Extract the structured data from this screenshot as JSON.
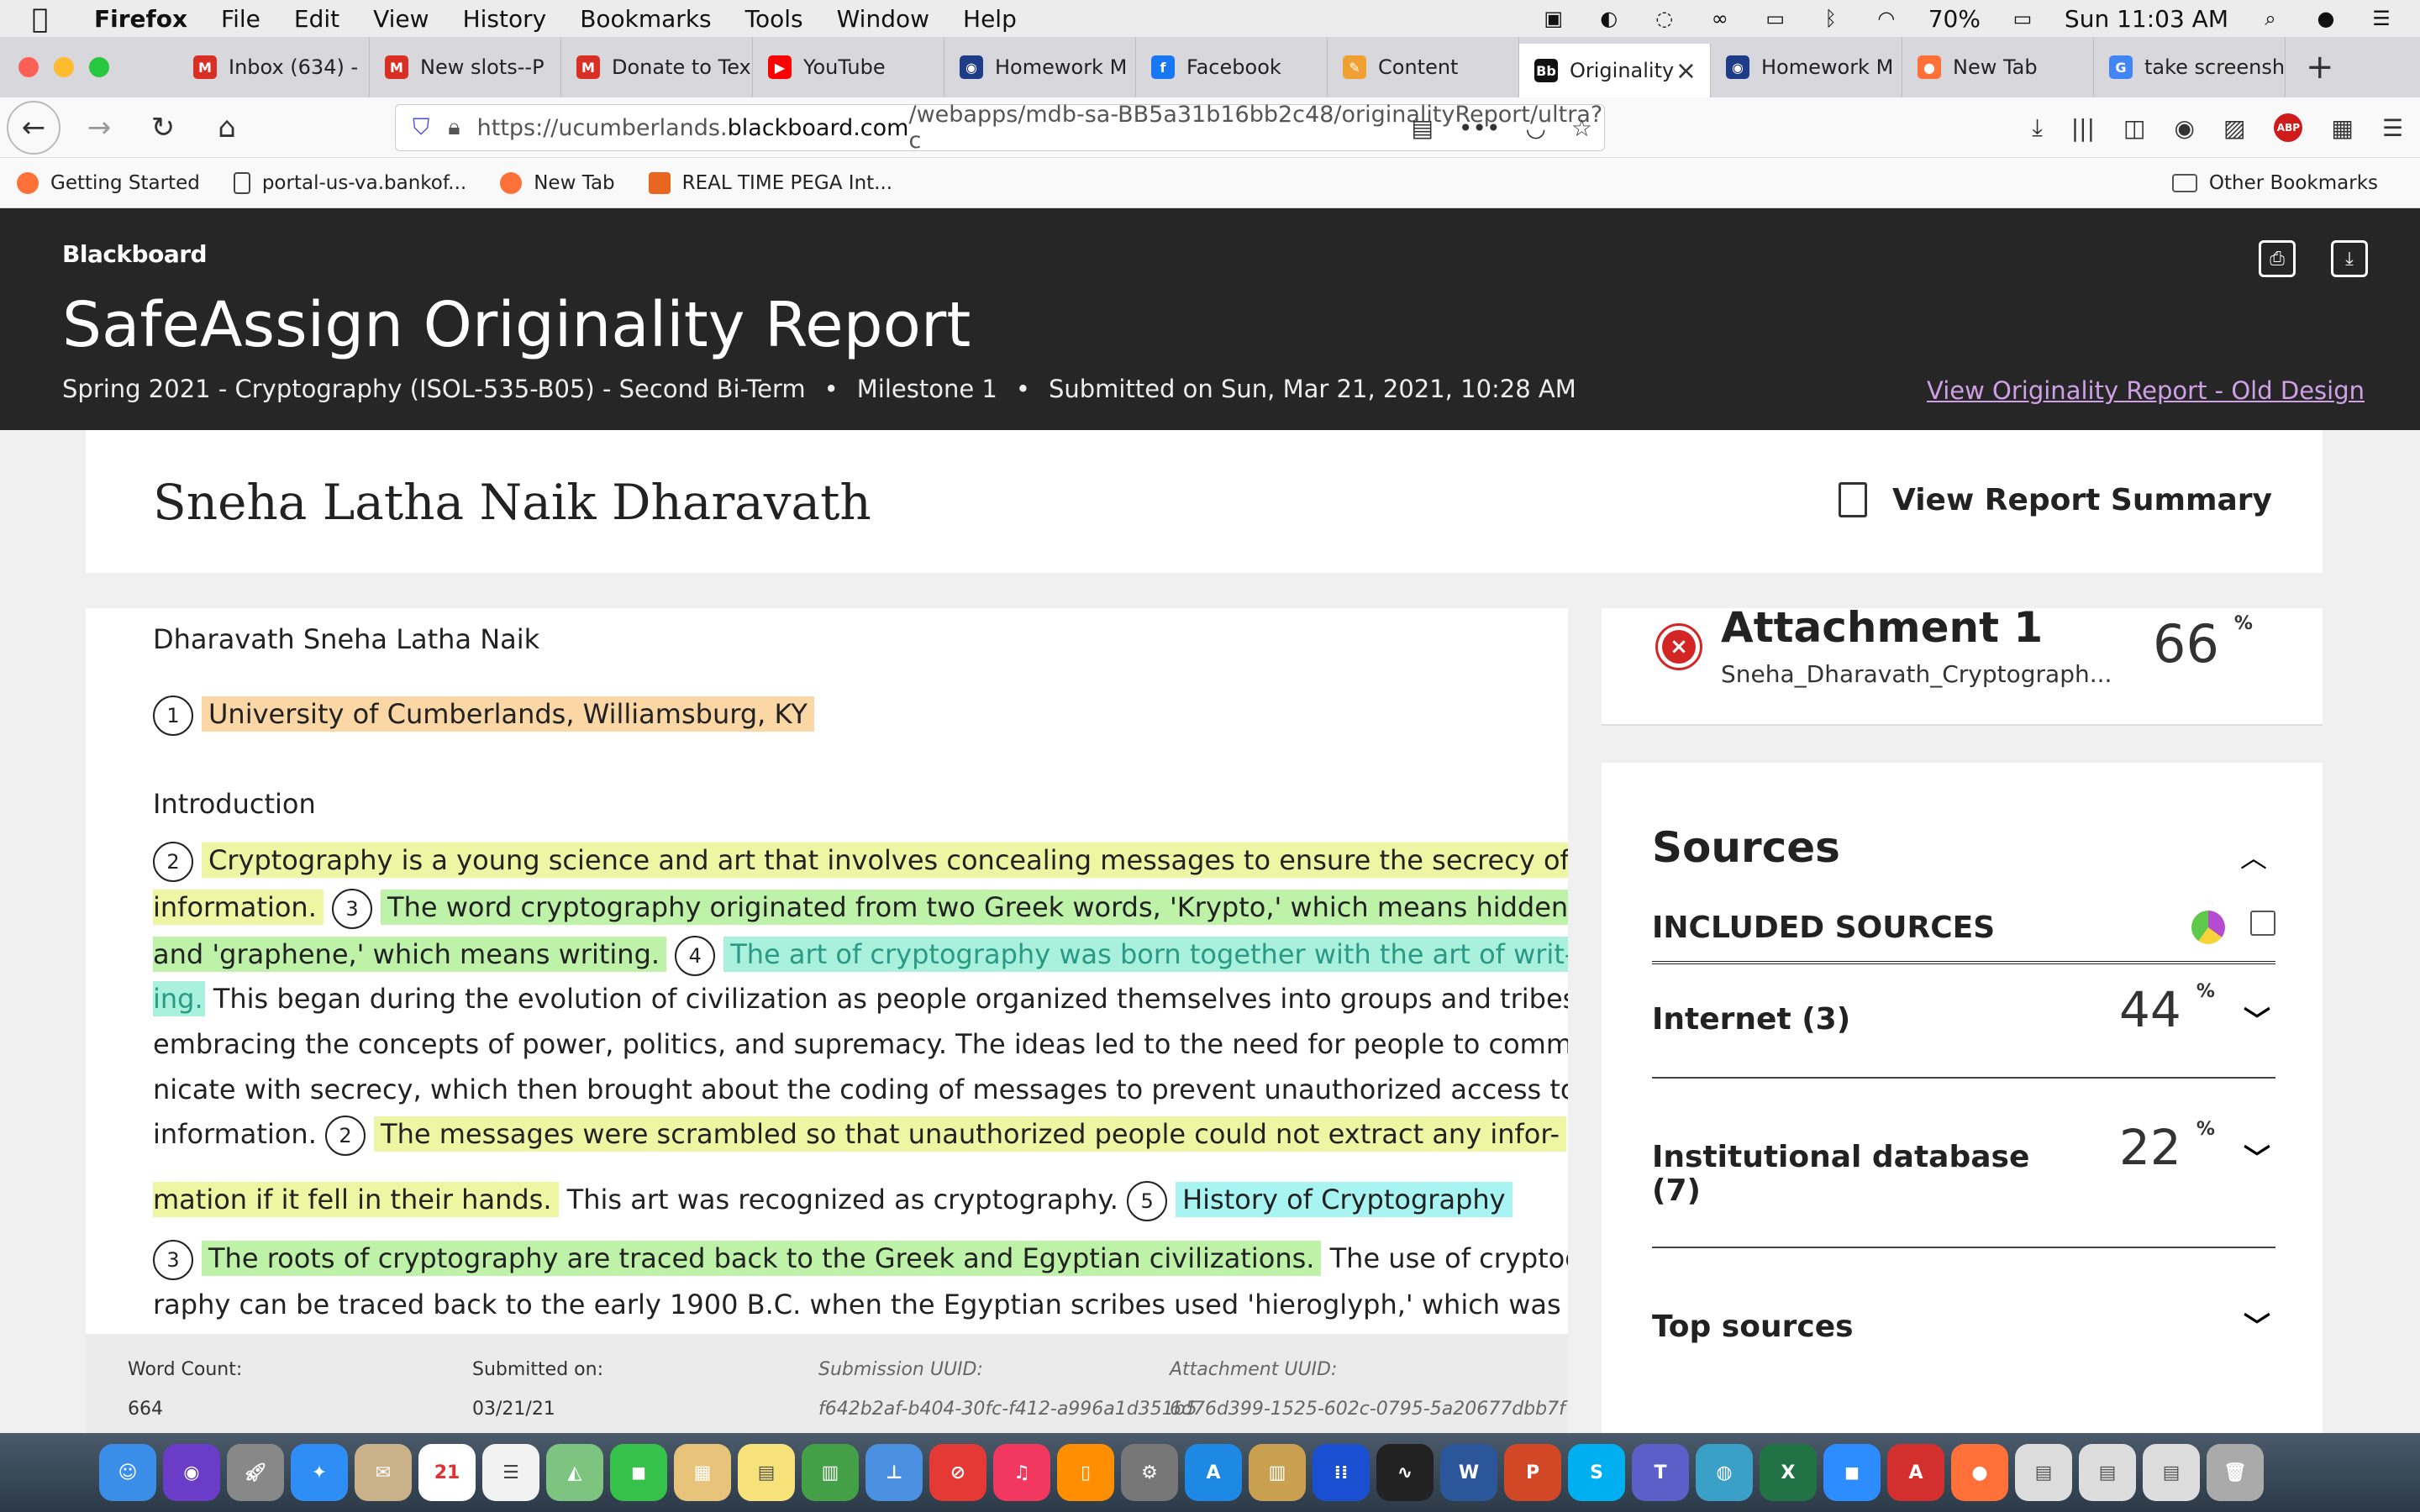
{
  "menubar": {
    "app": "Firefox",
    "items": [
      "File",
      "Edit",
      "View",
      "History",
      "Bookmarks",
      "Tools",
      "Window",
      "Help"
    ],
    "battery": "70%",
    "clock": "Sun 11:03 AM"
  },
  "tabs": [
    {
      "label": "Inbox (634) -",
      "color": "#d93025",
      "glyph": "M"
    },
    {
      "label": "New slots--P",
      "color": "#d93025",
      "glyph": "M"
    },
    {
      "label": "Donate to Tex",
      "color": "#d93025",
      "glyph": "M"
    },
    {
      "label": "YouTube",
      "color": "#ff0000",
      "glyph": "▶"
    },
    {
      "label": "Homework M",
      "color": "#1f3c88",
      "glyph": "◉"
    },
    {
      "label": "Facebook",
      "color": "#1877f2",
      "glyph": "f"
    },
    {
      "label": "Content",
      "color": "#f0a030",
      "glyph": "✎"
    },
    {
      "label": "Originality",
      "color": "#111111",
      "glyph": "Bb",
      "active": true
    },
    {
      "label": "Homework M",
      "color": "#1f3c88",
      "glyph": "◉"
    },
    {
      "label": "New Tab",
      "color": "#ff7139",
      "glyph": "●"
    },
    {
      "label": "take screensh",
      "color": "#4285f4",
      "glyph": "G"
    }
  ],
  "url": {
    "prefix": "https://ucumberlands.",
    "host": "blackboard.com",
    "path": "/webapps/mdb-sa-BB5a31b16bb2c48/originalityReport/ultra?c"
  },
  "bookmarks": {
    "items": [
      "Getting Started",
      "portal-us-va.bankof...",
      "New Tab",
      "REAL TIME PEGA Int..."
    ],
    "other": "Other Bookmarks"
  },
  "header": {
    "brand": "Blackboard",
    "title": "SafeAssign Originality Report",
    "course": "Spring 2021 - Cryptography (ISOL-535-B05) - Second Bi-Term",
    "milestone": "Milestone 1",
    "submitted": "Submitted on Sun, Mar 21, 2021, 10:28 AM",
    "old_design_link": "View Originality Report - Old Design"
  },
  "student": {
    "name": "Sneha Latha Naik Dharavath",
    "summary_label": "View Report Summary"
  },
  "document": {
    "author": "Dharavath Sneha Latha Naik",
    "affiliation": "University of Cumberlands, Williamsburg, KY",
    "intro_heading": "Introduction",
    "l1": "Cryptography is a young science and art that involves concealing messages to ensure the secrecy of",
    "l2a": "information.",
    "l2b": "The word cryptography originated from two Greek words, 'Krypto,' which means hidden,",
    "l3a": "and 'graphene,' which means writing.",
    "l3b": "The art of cryptography was born together with the art of writ-",
    "l4a": "ing.",
    "l4b": "This began during the evolution of civilization as people organized themselves into groups and tribes,",
    "l5": "embracing the concepts of power, politics, and supremacy. The ideas led to the need for people to commu-",
    "l6": "nicate with secrecy, which then brought about the coding of messages to prevent unauthorized access to",
    "l7a": "information.",
    "l7b": "The messages were scrambled so that unauthorized people could not extract any infor-",
    "l8a": "mation if it fell in their hands.",
    "l8b": "This art was recognized as cryptography.",
    "l8c": "History of Cryptography",
    "l9a": "The roots of cryptography are traced back to the Greek and Egyptian civilizations.",
    "l9b": "The use of cryptog-",
    "l10": "raphy can be traced back to the early 1900 B.C. when the Egyptian scribes used 'hieroglyph,' which was a",
    "markers": [
      "1",
      "2",
      "3",
      "4",
      "2",
      "5",
      "3"
    ]
  },
  "footer": {
    "word_count_label": "Word Count:",
    "word_count": "664",
    "submitted_label": "Submitted on:",
    "submitted_date": "03/21/21",
    "submission_uuid_label": "Submission UUID:",
    "submission_uuid": "f642b2af-b404-30fc-f412-a996a1d351b5",
    "attachment_uuid_label": "Attachment UUID:",
    "attachment_uuid": "6d76d399-1525-602c-0795-5a20677dbb7f"
  },
  "attachment": {
    "title": "Attachment 1",
    "file": "Sneha_Dharavath_Cryptograph...",
    "percent": "66",
    "pct_sign": "%"
  },
  "sources": {
    "title": "Sources",
    "included_label": "INCLUDED SOURCES",
    "rows": [
      {
        "name": "Internet (3)",
        "percent": "44"
      },
      {
        "name": "Institutional database",
        "name2": "(7)",
        "percent": "22"
      },
      {
        "name": "Top sources"
      }
    ]
  }
}
